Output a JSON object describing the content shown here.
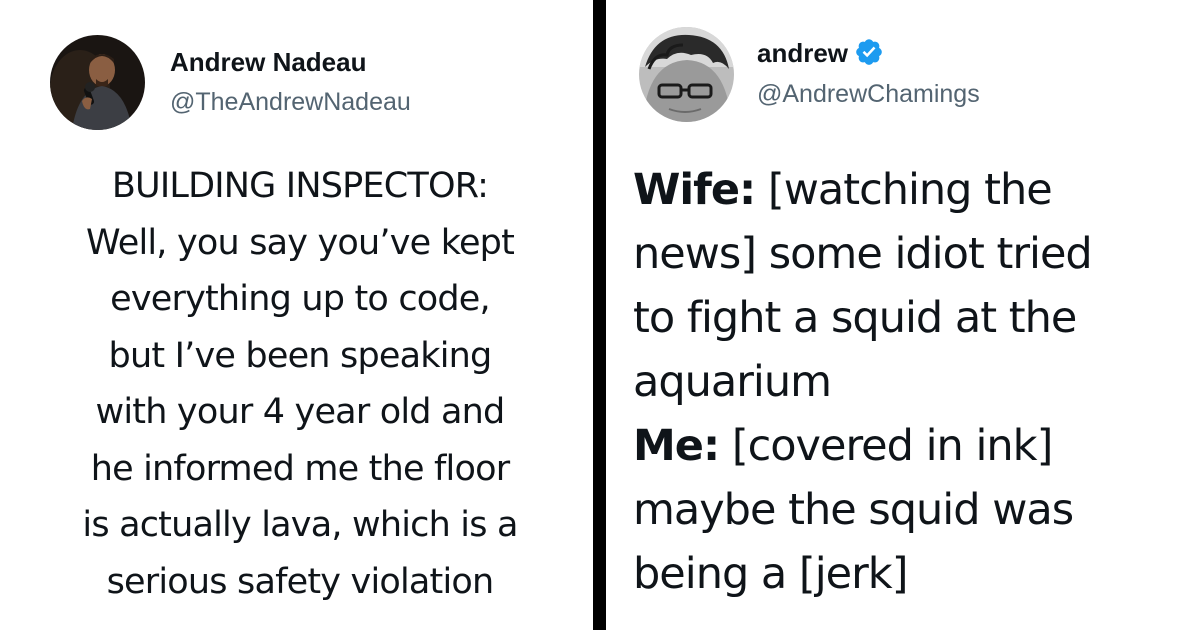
{
  "left_tweet": {
    "author": {
      "display_name": "Andrew Nadeau",
      "handle": "@TheAndrewNadeau",
      "avatar_icon": "comedian-with-microphone-avatar"
    },
    "lines": [
      "BUILDING INSPECTOR:",
      "Well, you say you’ve kept",
      "everything up to code,",
      "but I’ve been speaking",
      "with your 4 year old and",
      "he informed me the floor",
      "is actually lava, which is a",
      "serious safety violation"
    ]
  },
  "right_tweet": {
    "author": {
      "display_name": "andrew",
      "handle": "@AndrewChamings",
      "verified": true,
      "avatar_icon": "man-with-glasses-avatar"
    },
    "line1": {
      "speaker": "Wife:",
      "text": " [watching the"
    },
    "line2": "news] some idiot tried",
    "line3": "to fight a squid at the",
    "line4": "aquarium",
    "line5": {
      "speaker": "Me:",
      "text": " [covered in ink]"
    },
    "line6": "maybe the squid was",
    "line7": "being a [jerk]"
  },
  "colors": {
    "text": "#0f1419",
    "handle": "#536471",
    "verified_badge": "#1d9bf0",
    "divider": "#000000",
    "background": "#ffffff"
  }
}
